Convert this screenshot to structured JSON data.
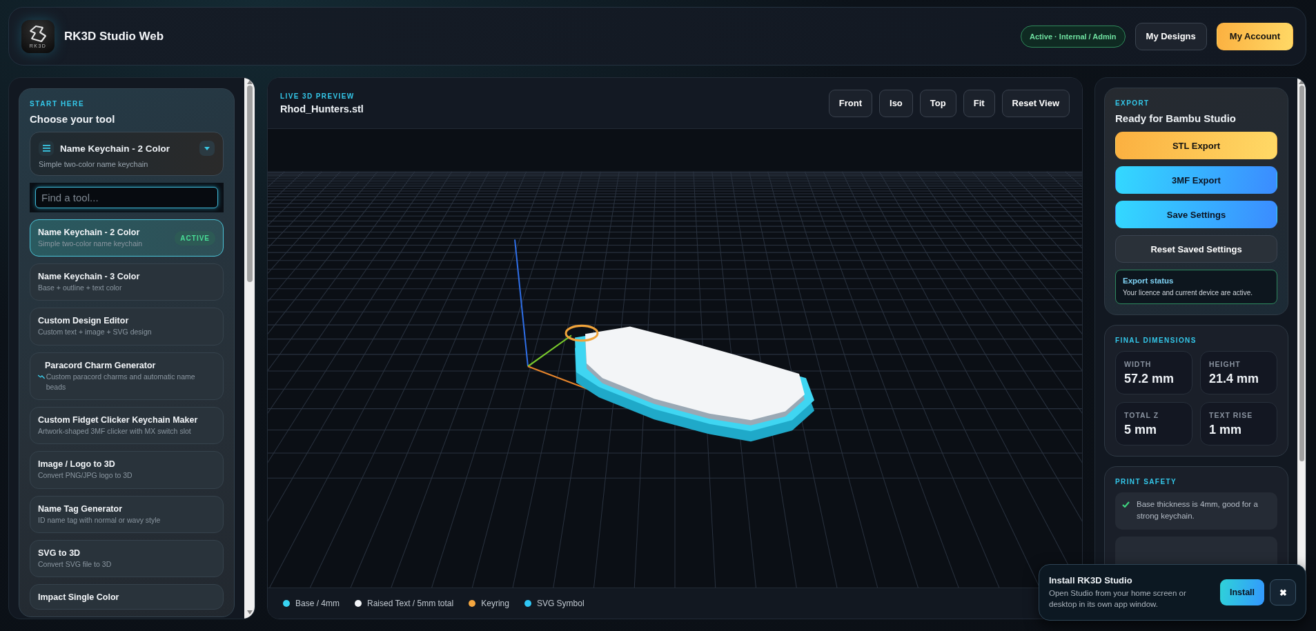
{
  "header": {
    "logo_text": "RK3D",
    "app_name": "RK3D Studio Web",
    "status_badge": "Active · Internal / Admin",
    "buttons": [
      {
        "label": "My Designs",
        "kind": "secondary"
      },
      {
        "label": "My Account",
        "kind": "primary"
      }
    ]
  },
  "tool_picker": {
    "eyebrow": "START HERE",
    "title": "Choose your tool",
    "current": {
      "name": "Name Keychain - 2 Color",
      "description": "Simple two-color name keychain"
    },
    "search": {
      "placeholder": "Find a tool..."
    },
    "items": [
      {
        "name": "Name Keychain - 2 Color",
        "description": "Simple two-color name keychain",
        "badge": "ACTIVE",
        "selected": true,
        "kind": "plain"
      },
      {
        "name": "Name Keychain - 3 Color",
        "description": "Base + outline + text color",
        "selected": false,
        "kind": "plain"
      },
      {
        "name": "Custom Design Editor",
        "description": "Custom text + image + SVG design",
        "selected": false,
        "kind": "plain"
      },
      {
        "name": "Paracord Charm Generator",
        "description": "Custom paracord charms and automatic name beads",
        "selected": false,
        "kind": "icon"
      },
      {
        "name": "Custom Fidget Clicker Keychain Maker",
        "description": "Artwork-shaped 3MF clicker with MX switch slot",
        "selected": false,
        "kind": "plain"
      },
      {
        "name": "Image / Logo to 3D",
        "description": "Convert PNG/JPG logo to 3D",
        "selected": false,
        "kind": "plain"
      },
      {
        "name": "Name Tag Generator",
        "description": "ID name tag with normal or wavy style",
        "selected": false,
        "kind": "plain"
      },
      {
        "name": "SVG to 3D",
        "description": "Convert SVG file to 3D",
        "selected": false,
        "kind": "plain"
      },
      {
        "name": "Impact Single Color",
        "selected": false,
        "kind": "plain"
      }
    ]
  },
  "preview": {
    "eyebrow": "LIVE 3D PREVIEW",
    "file_name": "Rhod_Hunters.stl",
    "view_buttons": [
      "Front",
      "Iso",
      "Top",
      "Fit",
      "Reset View"
    ],
    "legend": [
      {
        "label": "Base / 4mm",
        "color": "#38d3f2"
      },
      {
        "label": "Raised Text / 5mm total",
        "color": "#f2f4f7"
      },
      {
        "label": "Keyring",
        "color": "#f4a640"
      },
      {
        "label": "SVG Symbol",
        "color": "#2fc6f4"
      }
    ]
  },
  "export": {
    "eyebrow": "EXPORT",
    "title": "Ready for Bambu Studio",
    "buttons": [
      {
        "label": "STL Export",
        "kind": "primary"
      },
      {
        "label": "3MF Export",
        "kind": "accent"
      },
      {
        "label": "Save Settings",
        "kind": "accent"
      },
      {
        "label": "Reset Saved Settings",
        "kind": "secondary"
      }
    ],
    "status": {
      "title": "Export status",
      "message": "Your licence and current device are active."
    }
  },
  "dimensions": {
    "eyebrow": "FINAL DIMENSIONS",
    "stats": [
      {
        "label": "WIDTH",
        "value": "57.2 mm"
      },
      {
        "label": "HEIGHT",
        "value": "21.4 mm"
      },
      {
        "label": "TOTAL Z",
        "value": "5 mm"
      },
      {
        "label": "TEXT RISE",
        "value": "1 mm"
      }
    ]
  },
  "print_safety": {
    "eyebrow": "PRINT SAFETY",
    "items": [
      "Base thickness is 4mm, good for a strong keychain."
    ]
  },
  "install_prompt": {
    "title": "Install RK3D Studio",
    "message": "Open Studio from your home screen or desktop in its own app window.",
    "install_button": "Install",
    "close_button": "✖"
  }
}
